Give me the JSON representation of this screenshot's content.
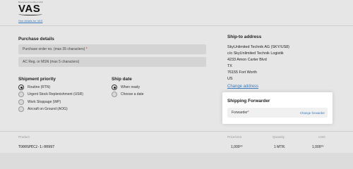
{
  "brand": {
    "tagline": "Brand and Certified VAS",
    "logo_text": "VAS",
    "details_link": "See details for VAS"
  },
  "purchase": {
    "title": "Purchase details",
    "po_placeholder": "Purchase order no. (max 35 characters)",
    "po_required": "*",
    "ac_placeholder": "AC Reg. or MSN (max 5 characters)"
  },
  "priority": {
    "title": "Shipment priority",
    "options": [
      {
        "label": "Routine (RTN)",
        "selected": true
      },
      {
        "label": "Urgent Stock Replenishment (USR)",
        "selected": false
      },
      {
        "label": "Work Stoppage (WP)",
        "selected": false
      },
      {
        "label": "Aircraft on Ground (AOG)",
        "selected": false
      }
    ]
  },
  "ship_date": {
    "title": "Ship date",
    "options": [
      {
        "label": "When ready",
        "selected": true
      },
      {
        "label": "Choose a date",
        "selected": false
      }
    ]
  },
  "ship_to": {
    "title": "Ship-to address",
    "lines": [
      "SkyUnlimited Technik AG (SKY/US8)",
      "c/o SkyUnlimited Technik Logistik",
      "4233 Amon Carter Blvd",
      "TX",
      "76155 Fort Worth",
      "US"
    ],
    "change_link": "Change address"
  },
  "forwarder": {
    "title": "Shipping Forwarder",
    "label": "Forwarder",
    "required": "*",
    "change_link": "Change forwarder"
  },
  "table": {
    "headers": {
      "product": "Product",
      "price_unit": "Price/Unit",
      "quantity": "Quantity",
      "currency": "USD"
    },
    "row": {
      "product": "TO00SPEC2-1:00997",
      "price_unit": "1,000⁰⁰",
      "quantity": "1 MTR.",
      "total": "1,000⁰⁰"
    }
  }
}
